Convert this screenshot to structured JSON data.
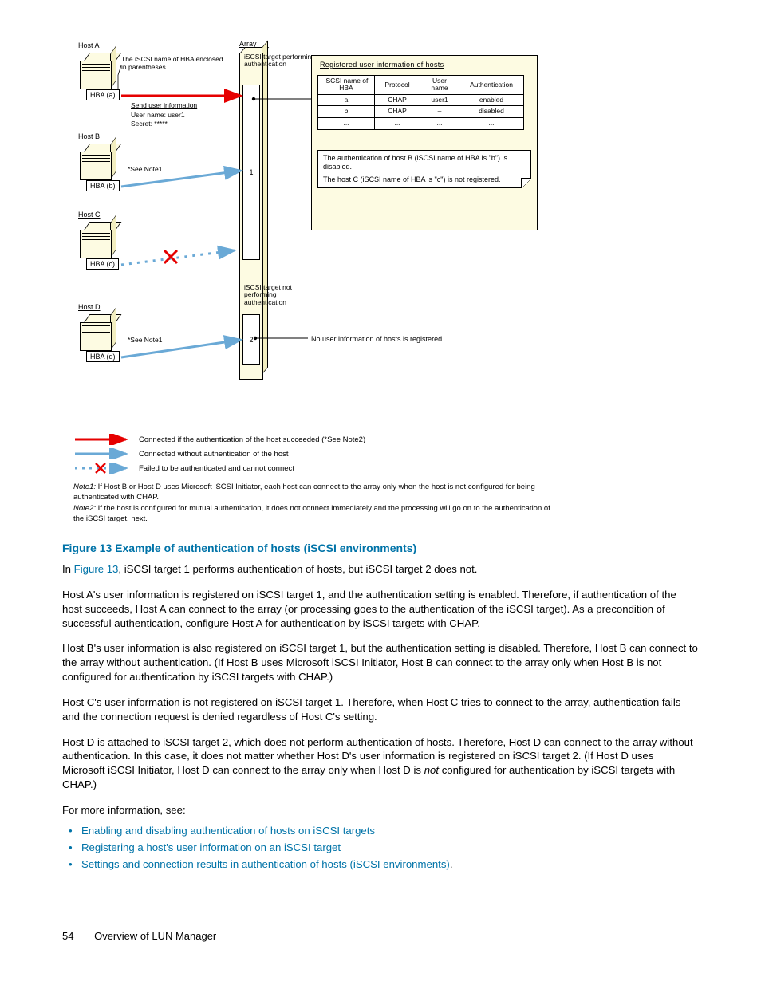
{
  "diagram": {
    "array_label": "Array",
    "hosts": [
      {
        "label": "Host A",
        "hba": "HBA (a)"
      },
      {
        "label": "Host B",
        "hba": "HBA (b)"
      },
      {
        "label": "Host C",
        "hba": "HBA (c)"
      },
      {
        "label": "Host D",
        "hba": "HBA (d)"
      }
    ],
    "hba_caption": "The iSCSI name of HBA enclosed in parentheses",
    "send_info": "Send user information",
    "user_line": "User name: user1",
    "secret_line": "Secret: *****",
    "see_note1": "*See Note1",
    "tgt_note_1": "iSCSI target performing authentication",
    "tgt_note_2": "iSCSI target not performing authentication",
    "tgt1": "1",
    "tgt2": "2",
    "info_title": "Registered user information of hosts",
    "info_headers": [
      "iSCSI name of HBA",
      "Protocol",
      "User name",
      "Authentication"
    ],
    "info_rows": [
      [
        "a",
        "CHAP",
        "user1",
        "enabled"
      ],
      [
        "b",
        "CHAP",
        "–",
        "disabled"
      ],
      [
        "...",
        "...",
        "...",
        "..."
      ]
    ],
    "info_note_b": "The authentication of host B (iSCSI name of HBA is \"b\") is disabled.",
    "info_note_c": "The host C (iSCSI name of HBA is \"c\") is not registered.",
    "right_note_2": "No user information of hosts is registered."
  },
  "legend": {
    "l1": "Connected if the authentication of the host succeeded (*See Note2)",
    "l2": "Connected without authentication of the host",
    "l3": "Failed to be authenticated and cannot connect",
    "n1_label": "Note1:",
    "n1": "If Host B or Host D uses Microsoft iSCSI Initiator, each host can connect to the array only when the host is not configured for being authenticated with CHAP.",
    "n2_label": "Note2:",
    "n2": "If the host is configured for mutual authentication, it does not connect immediately and the processing will go on to the authentication of the iSCSI target, next."
  },
  "caption": "Figure 13 Example of authentication of hosts (iSCSI environments)",
  "para_intro_a": "In ",
  "para_intro_link": "Figure 13",
  "para_intro_b": ", iSCSI target 1 performs authentication of hosts, but iSCSI target 2 does not.",
  "para_a": "Host A's user information is registered on iSCSI target 1, and the authentication setting is enabled. Therefore, if authentication of the host succeeds, Host A can connect to the array (or processing goes to the authentication of the iSCSI target). As a precondition of successful authentication, configure Host A for authentication by iSCSI targets with CHAP.",
  "para_b": "Host B's user information is also registered on iSCSI target 1, but the authentication setting is disabled. Therefore, Host B can connect to the array without authentication. (If Host B uses Microsoft iSCSI Initiator, Host B can connect to the array only when Host B is not configured for authentication by iSCSI targets with CHAP.)",
  "para_c": "Host C's user information is not registered on iSCSI target 1. Therefore, when Host C tries to connect to the array, authentication fails and the connection request is denied regardless of Host C's setting.",
  "para_d_a": "Host D is attached to iSCSI target 2, which does not perform authentication of hosts. Therefore, Host D can connect to the array without authentication. In this case, it does not matter whether Host D's user information is registered on iSCSI target 2. (If Host D uses Microsoft iSCSI Initiator, Host D can connect to the array only when Host D is ",
  "para_d_not": "not",
  "para_d_b": " configured for authentication by iSCSI targets with CHAP.)",
  "more_info": "For more information, see:",
  "links": [
    "Enabling and disabling authentication of hosts on iSCSI targets",
    "Registering a host's user information on an iSCSI target",
    "Settings and connection results in authentication of hosts (iSCSI environments)"
  ],
  "footer": {
    "page": "54",
    "title": "Overview of LUN Manager"
  }
}
